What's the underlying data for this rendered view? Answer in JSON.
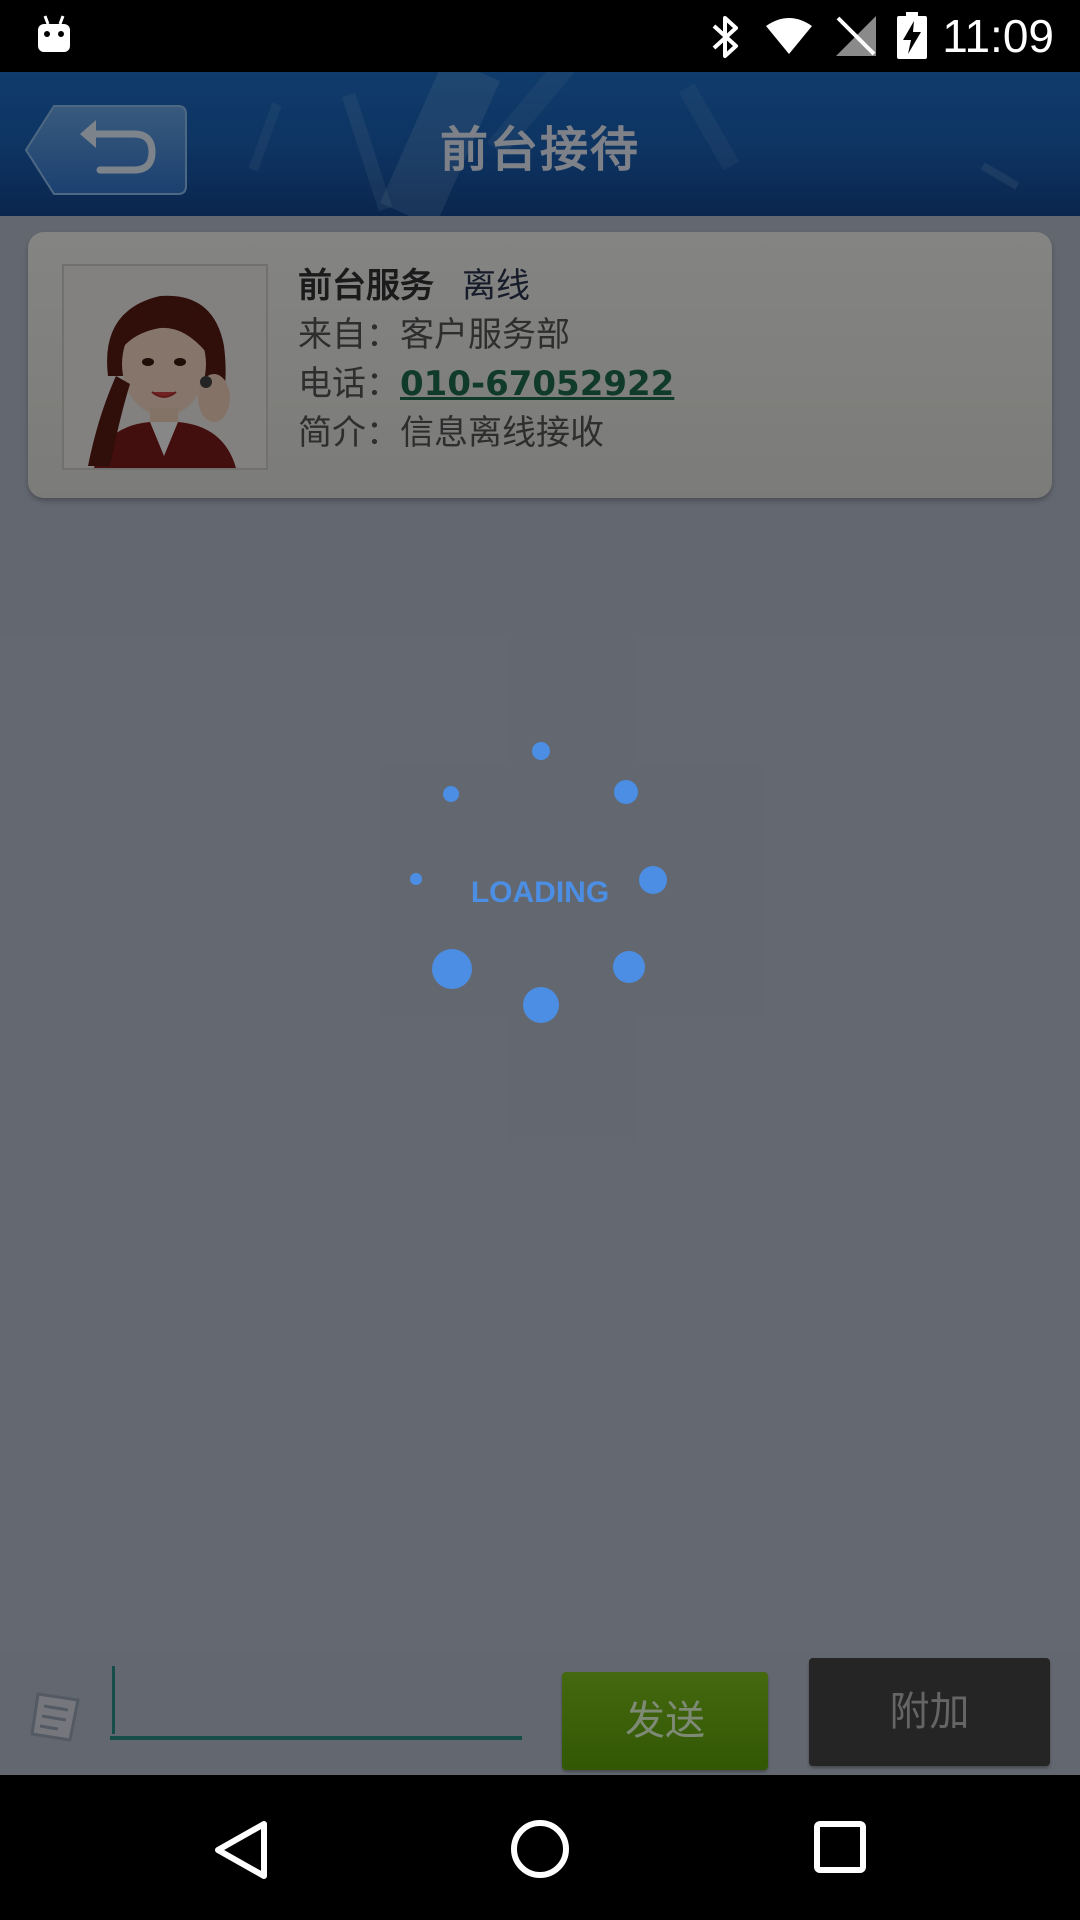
{
  "status_bar": {
    "time": "11:09",
    "icons": [
      "android-debug-icon",
      "bluetooth-icon",
      "wifi-icon",
      "signal-icon",
      "battery-charging-icon"
    ]
  },
  "header": {
    "title": "前台接待",
    "back_icon": "back-arrow-icon"
  },
  "contact": {
    "name": "前台服务",
    "status": "离线",
    "from_label": "来自：",
    "from_value": "客户服务部",
    "phone_label": "电话：",
    "phone_value": "010-67052922",
    "intro_label": "简介：",
    "intro_value": "信息离线接收"
  },
  "loading": {
    "text": "LOADING"
  },
  "input_bar": {
    "message_value": "",
    "send_label": "发送",
    "attach_label": "附加"
  },
  "colors": {
    "title_bar": "#1a5fb4",
    "send_button": "#6aad0f",
    "attach_button": "#454545",
    "loading_accent": "#4b8ee3",
    "phone_link": "#1f6b4e"
  },
  "nav_bar": {
    "icons": [
      "nav-back-icon",
      "nav-home-icon",
      "nav-recents-icon"
    ]
  }
}
